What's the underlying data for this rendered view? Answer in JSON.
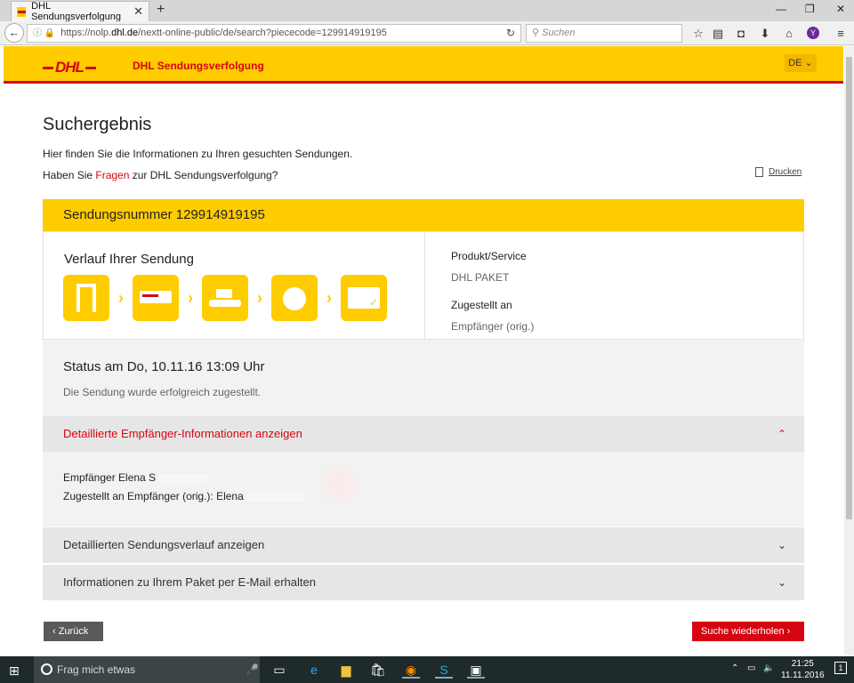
{
  "browser": {
    "tab_title": "DHL Sendungsverfolgung",
    "url_prefix": "https://nolp.",
    "url_domain": "dhl.de",
    "url_path": "/nextt-online-public/de/search?piececode=129914919195",
    "search_placeholder": "Suchen",
    "profile_initial": "Y"
  },
  "header": {
    "logo": "DHL",
    "title": "DHL Sendungsverfolgung",
    "language": "DE ⌄"
  },
  "page": {
    "heading": "Suchergebnis",
    "intro": "Hier finden Sie die Informationen zu Ihren gesuchten Sendungen.",
    "faq_prefix": "Haben Sie ",
    "faq_link": "Fragen",
    "faq_suffix": " zur DHL Sendungsverfolgung?",
    "print_label": "Drucken"
  },
  "shipment": {
    "number_label": "Sendungsnummer 129914919195",
    "history_title": "Verlauf Ihrer Sendung",
    "stages": [
      "received-icon",
      "truck-icon",
      "sorting-icon",
      "courier-icon",
      "delivered-icon"
    ],
    "product_label": "Produkt/Service",
    "product_value": "DHL PAKET",
    "delivered_to_label": "Zugestellt an",
    "delivered_to_value": "Empfänger (orig.)",
    "status_title": "Status am Do, 10.11.16 13:09 Uhr",
    "status_text": "Die Sendung wurde erfolgreich zugestellt."
  },
  "accordions": {
    "recipient_details": "Detaillierte Empfänger-Informationen anzeigen",
    "recipient_line1": "Empfänger Elena S",
    "recipient_line2": "Zugestellt an Empfänger (orig.): Elena",
    "history": "Detaillierten Sendungsverlauf anzeigen",
    "email": "Informationen zu Ihrem Paket per E-Mail erhalten"
  },
  "buttons": {
    "back": "‹  Zurück",
    "repeat": "Suche wiederholen  ›"
  },
  "taskbar": {
    "search_placeholder": "Frag mich etwas",
    "time": "21:25",
    "date": "11.11.2016",
    "notifications": "1"
  },
  "colors": {
    "dhl_yellow": "#ffcc00",
    "dhl_red": "#d40511"
  }
}
